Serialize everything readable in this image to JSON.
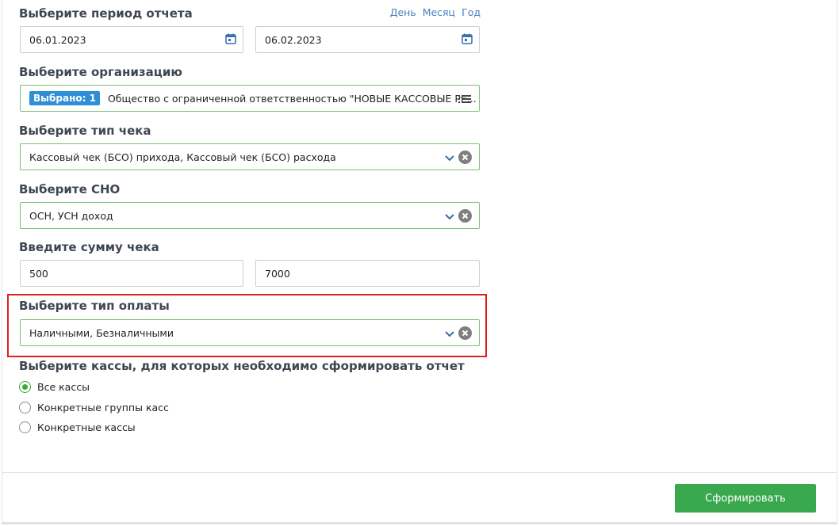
{
  "period": {
    "label": "Выберите период отчета",
    "links": [
      "День",
      "Месяц",
      "Год"
    ],
    "date_from": "06.01.2023",
    "date_to": "06.02.2023"
  },
  "organization": {
    "label": "Выберите организацию",
    "badge": "Выбрано: 1",
    "value": "Общество с ограниченной ответственностью \"НОВЫЕ КАССОВЫЕ РЕ..."
  },
  "receipt_type": {
    "label": "Выберите тип чека",
    "value": "Кассовый чек (БСО) прихода, Кассовый чек (БСО) расхода"
  },
  "sno": {
    "label": "Выберите СНО",
    "value": "ОСН, УСН доход"
  },
  "amount": {
    "label": "Введите сумму чека",
    "from": "500",
    "to": "7000"
  },
  "payment_type": {
    "label": "Выберите тип оплаты",
    "value": "Наличными, Безналичными"
  },
  "registers": {
    "label": "Выберите кассы, для которых необходимо сформировать отчет",
    "options": [
      "Все кассы",
      "Конкретные группы касс",
      "Конкретные кассы"
    ],
    "selected_index": 0
  },
  "submit_label": "Сформировать",
  "colors": {
    "accent_green": "#3aa84f",
    "link_blue": "#4a7fbf",
    "badge_blue": "#2e8fd6",
    "highlight_red": "#e02020"
  }
}
